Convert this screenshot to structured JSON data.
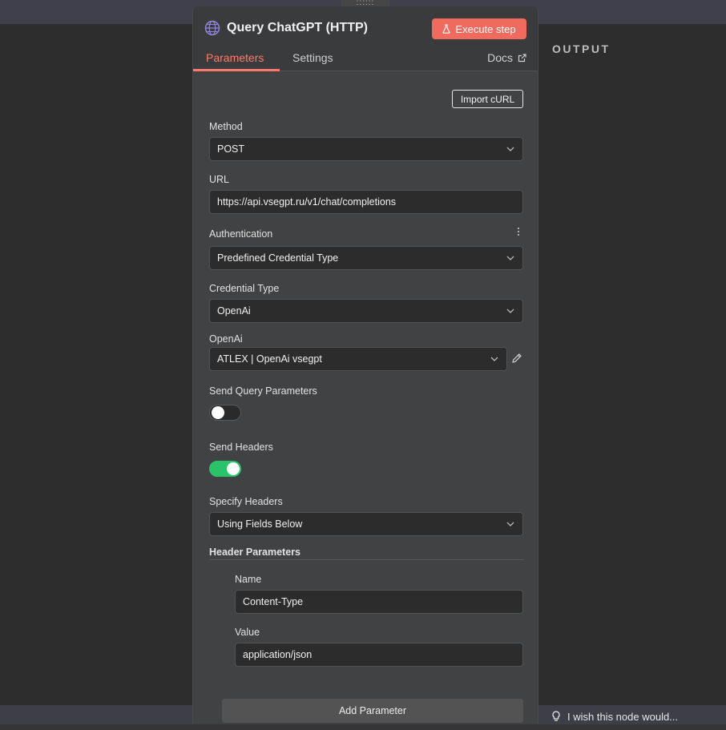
{
  "panel": {
    "title": "Query ChatGPT (HTTP)",
    "title_icon": "globe-icon",
    "execute_label": "Execute step",
    "tabs": [
      {
        "label": "Parameters",
        "active": true
      },
      {
        "label": "Settings",
        "active": false
      }
    ],
    "docs_label": "Docs",
    "accent_color": "#f06a5d"
  },
  "import_curl_label": "Import cURL",
  "form": {
    "method": {
      "label": "Method",
      "value": "POST"
    },
    "url": {
      "label": "URL",
      "value": "https://api.vsegpt.ru/v1/chat/completions"
    },
    "authentication": {
      "label": "Authentication",
      "value": "Predefined Credential Type"
    },
    "credential_type": {
      "label": "Credential Type",
      "value": "OpenAi"
    },
    "openai": {
      "label": "OpenAi",
      "value": "ATLEX | OpenAi vsegpt"
    },
    "send_query": {
      "label": "Send Query Parameters",
      "enabled": false
    },
    "send_headers": {
      "label": "Send Headers",
      "enabled": true
    },
    "specify_headers": {
      "label": "Specify Headers",
      "value": "Using Fields Below"
    },
    "header_parameters": {
      "label": "Header Parameters",
      "name_label": "Name",
      "name_value": "Content-Type",
      "value_label": "Value",
      "value_value": "application/json"
    },
    "add_parameter_label": "Add Parameter"
  },
  "output_label": "OUTPUT",
  "feedback_text": "I wish this node would..."
}
